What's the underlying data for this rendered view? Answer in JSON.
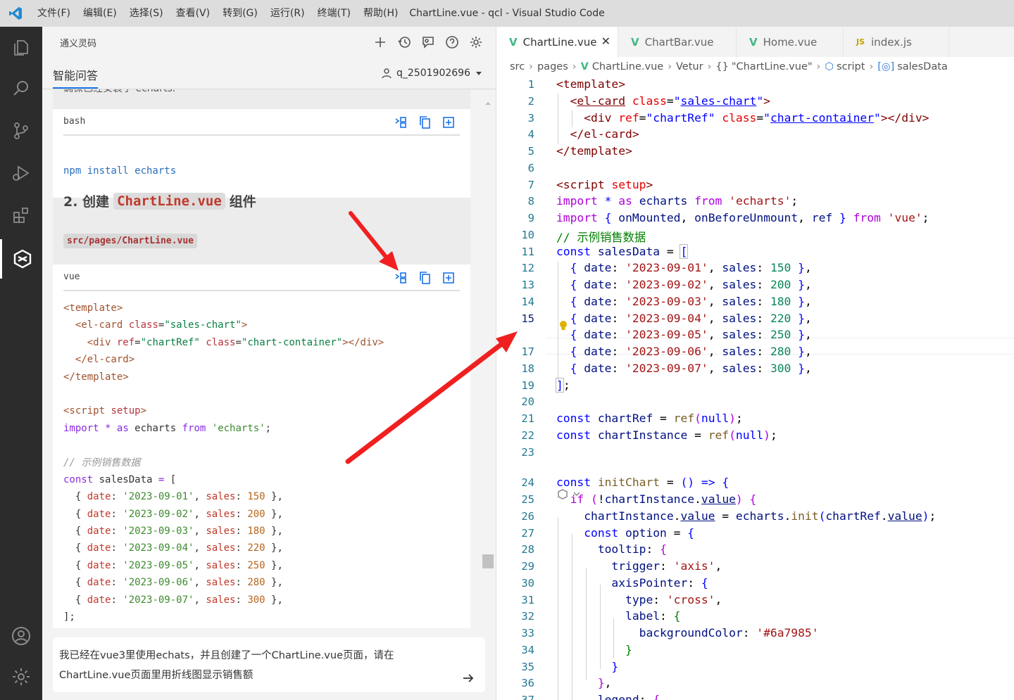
{
  "titlebar": {
    "menus": [
      "文件(F)",
      "编辑(E)",
      "选择(S)",
      "查看(V)",
      "转到(G)",
      "运行(R)",
      "终端(T)",
      "帮助(H)"
    ],
    "window_title": "ChartLine.vue - qcl - Visual Studio Code"
  },
  "activity_icons": [
    "explorer-icon",
    "search-icon",
    "source-control-icon",
    "run-debug-icon",
    "extensions-icon",
    "tongyi-lingma-icon",
    "account-icon",
    "settings-gear-icon"
  ],
  "sidepanel": {
    "title": "通义灵码",
    "tab": "智能问答",
    "user": "q_2501902696",
    "cut_text": "确保已经安装了 echarts.",
    "bash_block": {
      "lang": "bash",
      "code": "npm install echarts"
    },
    "heading": {
      "prefix": "2. 创建",
      "code": "ChartLine.vue",
      "suffix": "组件"
    },
    "path_tag": "src/pages/ChartLine.vue",
    "vue_block": {
      "lang": "vue"
    },
    "input_text": "我已经在vue3里使用echats，并且创建了一个ChartLine.vue页面，请在ChartLine.vue页面里用折线图显示销售额"
  },
  "editor": {
    "tabs": [
      {
        "label": "ChartLine.vue",
        "type": "vue",
        "active": true
      },
      {
        "label": "ChartBar.vue",
        "type": "vue",
        "active": false
      },
      {
        "label": "Home.vue",
        "type": "vue",
        "active": false
      },
      {
        "label": "index.js",
        "type": "js",
        "active": false
      }
    ],
    "breadcrumb": [
      "src",
      "pages",
      "ChartLine.vue",
      "Vetur",
      "\"ChartLine.vue\"",
      "script",
      "salesData"
    ],
    "line_numbers": [
      "1",
      "2",
      "3",
      "4",
      "5",
      "6",
      "7",
      "8",
      "9",
      "10",
      "11",
      "12",
      "13",
      "14",
      "15",
      "17",
      "18",
      "19",
      "20",
      "21",
      "22",
      "23",
      "24",
      "25",
      "26",
      "27",
      "28",
      "29",
      "30",
      "31",
      "32",
      "33",
      "34",
      "35",
      "36",
      "37"
    ],
    "current_line": "15"
  },
  "colors": {
    "accent": "#1a73e8",
    "arrow": "#f02020",
    "vue": "#41b883"
  }
}
